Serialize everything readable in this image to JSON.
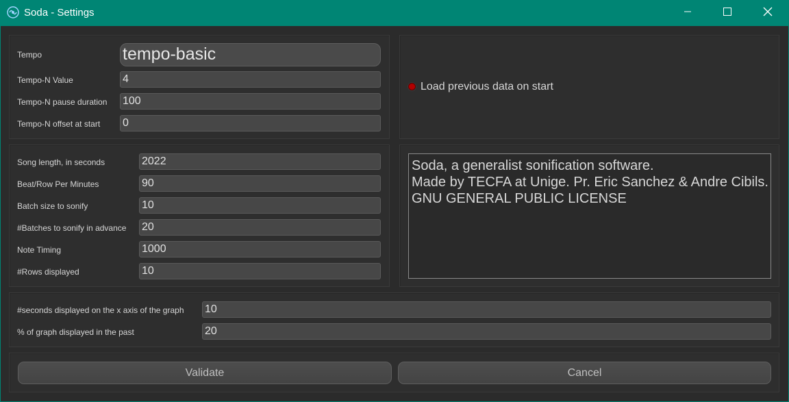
{
  "window": {
    "title": "Soda - Settings",
    "accent_color": "#008574",
    "icons": {
      "app": "soda-logo-icon",
      "minimize": "minimize-icon",
      "maximize": "maximize-icon",
      "close": "close-icon"
    }
  },
  "tempo": {
    "label": "Tempo",
    "selected": "tempo-basic",
    "n_value_label": "Tempo-N Value",
    "n_value": "4",
    "pause_label": "Tempo-N pause duration",
    "pause": "100",
    "offset_label": "Tempo-N offset at start",
    "offset": "0"
  },
  "load_previous": {
    "label": "Load previous data on start",
    "indicator_color": "#b10000"
  },
  "song": {
    "length_label": "Song length, in seconds",
    "length": "2022",
    "bpm_label": "Beat/Row Per Minutes",
    "bpm": "90",
    "batch_label": "Batch size to sonify",
    "batch": "10",
    "advance_label": "#Batches to sonify in advance",
    "advance": "20",
    "timing_label": "Note Timing",
    "timing": "1000",
    "rows_label": "#Rows displayed",
    "rows": "10"
  },
  "about": {
    "line1": "Soda, a generalist sonification software.",
    "line2": "Made by TECFA at Unige. Pr. Eric Sanchez & Andre Cibils.",
    "line3": "GNU GENERAL PUBLIC LICENSE"
  },
  "graph": {
    "xaxis_label": "#seconds displayed on the x axis of the graph",
    "xaxis": "10",
    "past_label": "% of graph displayed in the past",
    "past": "20"
  },
  "actions": {
    "validate": "Validate",
    "cancel": "Cancel"
  }
}
